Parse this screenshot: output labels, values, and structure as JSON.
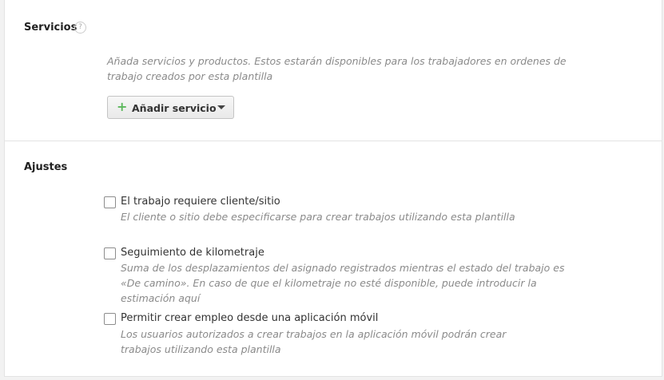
{
  "services": {
    "title": "Servicios",
    "help": "?",
    "description": "Añada servicios y productos. Estos estarán disponibles para los trabajadores en ordenes de trabajo creados por esta plantilla",
    "add_button": "Añadir servicio",
    "add_button_icon": "plus-icon",
    "dropdown_icon": "caret-down-icon"
  },
  "settings": {
    "title": "Ajustes",
    "options": [
      {
        "label": "El trabajo requiere cliente/sitio",
        "description": "El cliente o sitio debe especificarse para crear trabajos utilizando esta plantilla",
        "checked": false
      },
      {
        "label": "Seguimiento de kilometraje",
        "description": "Suma de los desplazamientos del asignado registrados mientras el estado del trabajo es «De camino». En caso de que el kilometraje no esté disponible, puede introducir la estimación aquí",
        "checked": false
      },
      {
        "label": "Permitir crear empleo desde una aplicación móvil",
        "description": "Los usuarios autorizados a crear trabajos en la aplicación móvil podrán crear trabajos utilizando esta plantilla",
        "checked": false
      }
    ]
  },
  "colors": {
    "accent_green": "#5cb85c",
    "background": "#f2f2f2",
    "card": "#ffffff"
  }
}
